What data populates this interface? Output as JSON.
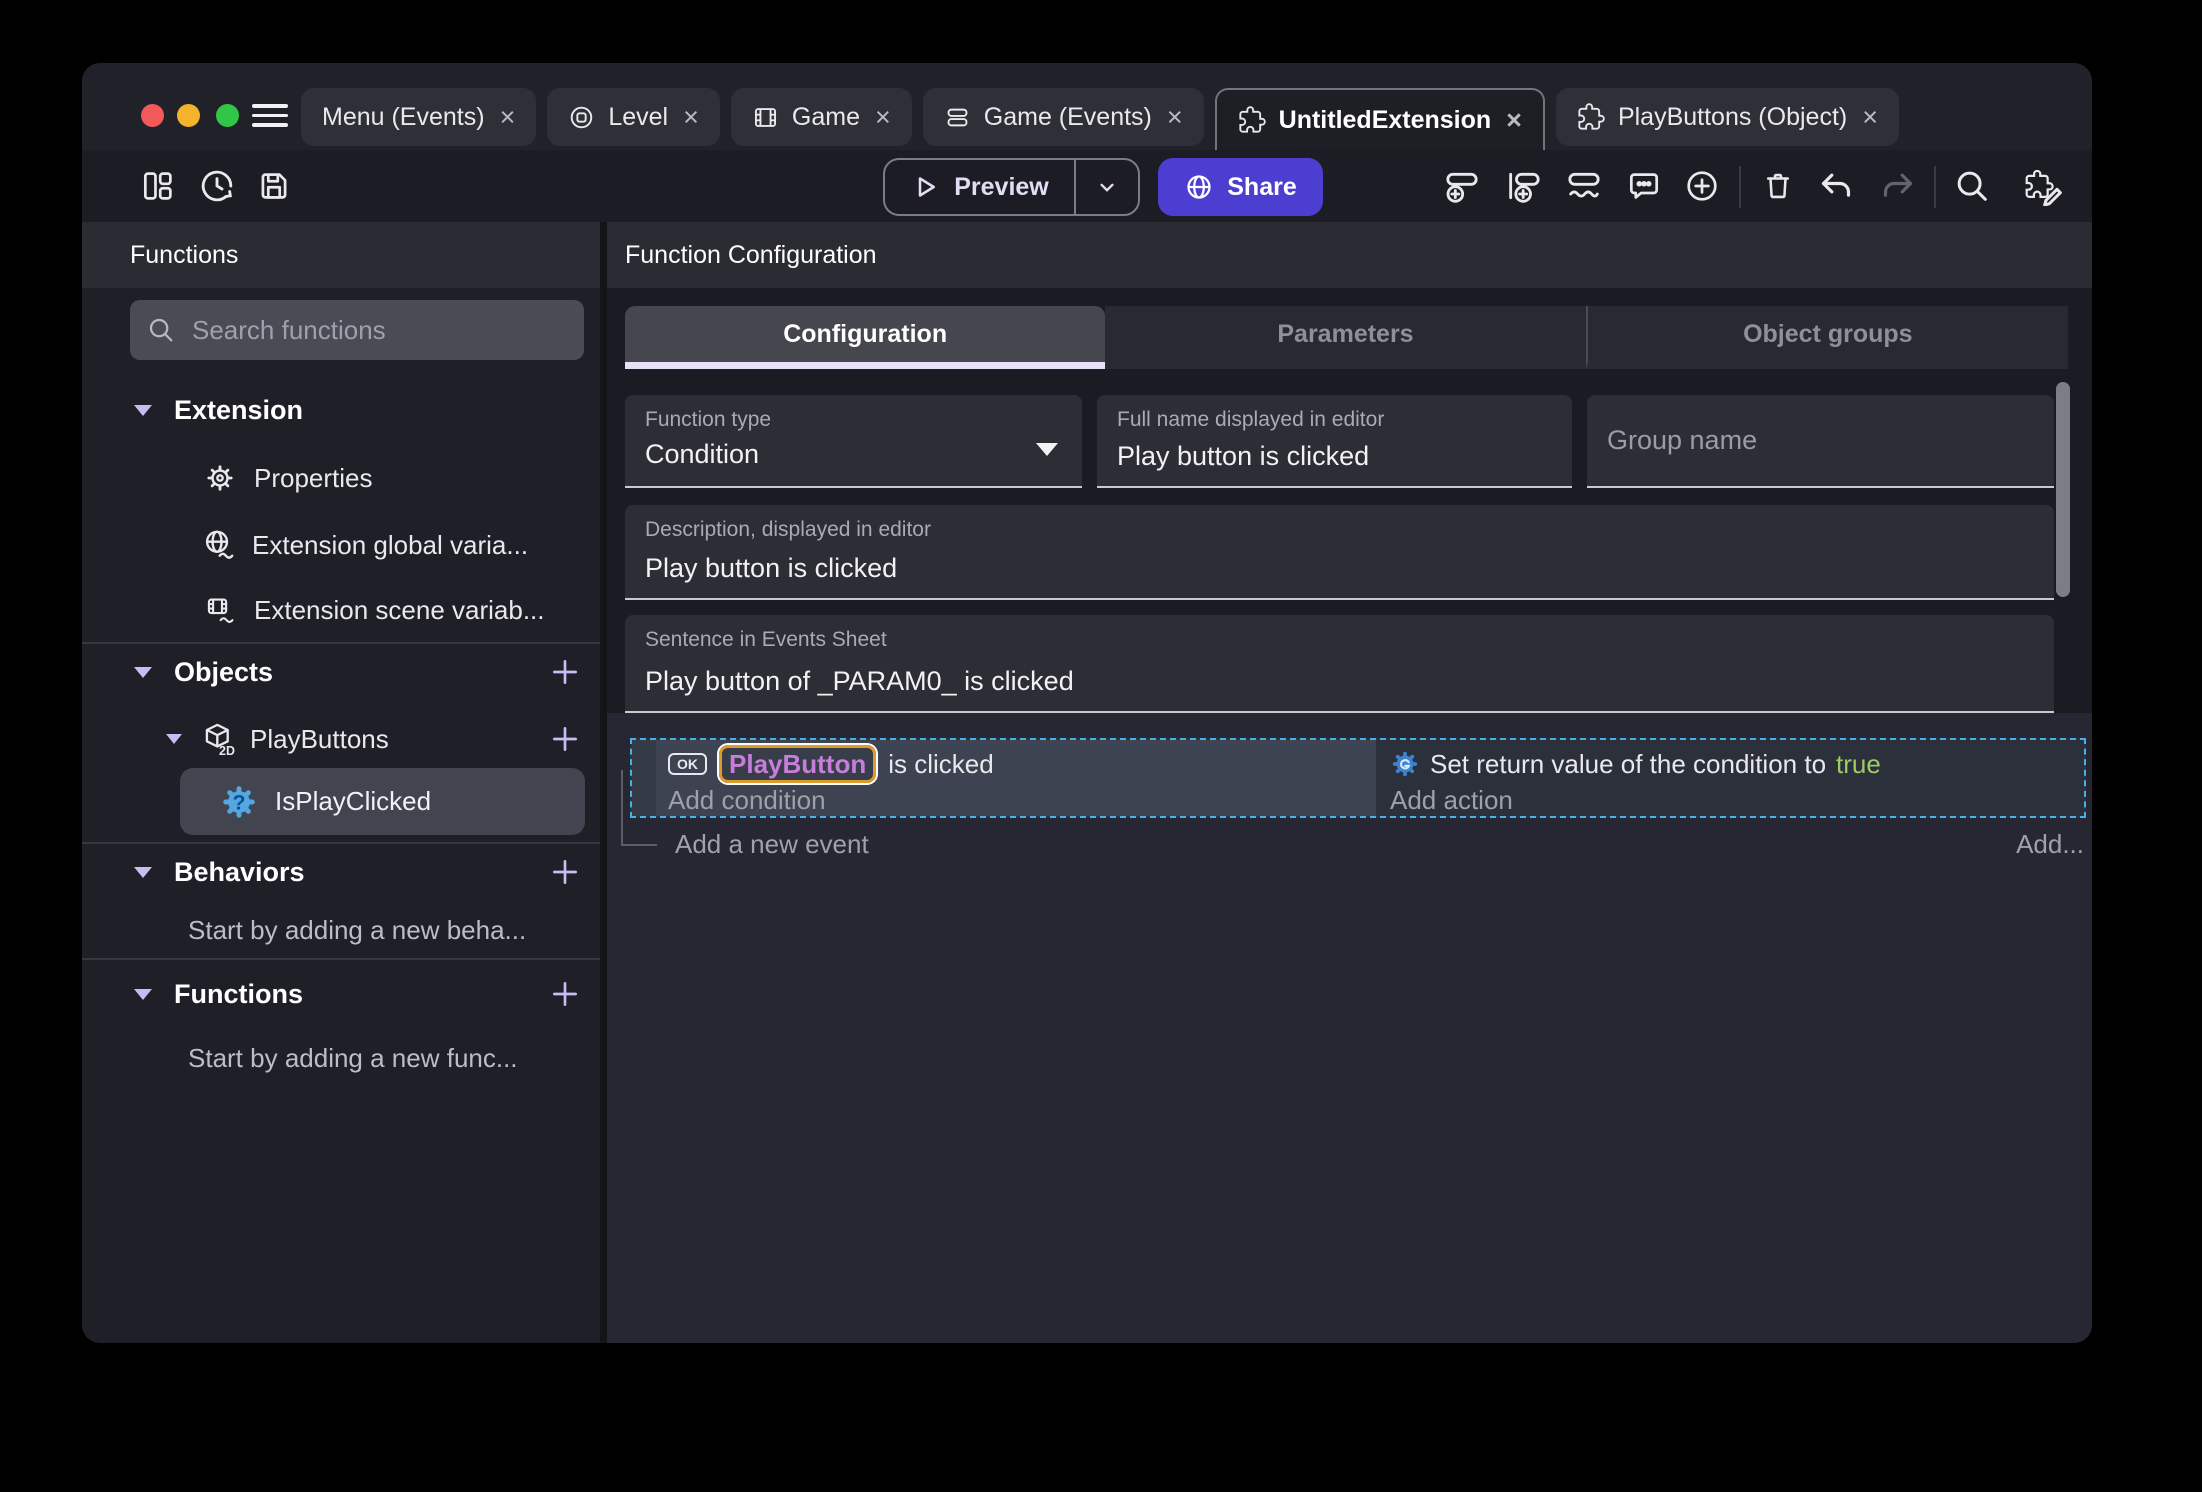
{
  "window_tabs": {
    "close_glyph": "×",
    "tabs": [
      {
        "label": "Menu (Events)"
      },
      {
        "label": "Level"
      },
      {
        "label": "Game"
      },
      {
        "label": "Game (Events)"
      },
      {
        "label": "UntitledExtension"
      },
      {
        "label": "PlayButtons (Object)"
      }
    ]
  },
  "toolbar": {
    "preview_label": "Preview",
    "share_label": "Share"
  },
  "sidebar": {
    "title": "Functions",
    "search_placeholder": "Search functions",
    "extension_header": "Extension",
    "items": {
      "properties": "Properties",
      "global_vars": "Extension global varia...",
      "scene_vars": "Extension scene variab..."
    },
    "objects_header": "Objects",
    "playbuttons": "PlayButtons",
    "playbuttons_badge": "2D",
    "selected_function": "IsPlayClicked",
    "behaviors_header": "Behaviors",
    "behaviors_empty": "Start by adding a new beha...",
    "functions_header": "Functions",
    "functions_empty": "Start by adding a new func..."
  },
  "main": {
    "title": "Function Configuration",
    "tabs": [
      {
        "label": "Configuration"
      },
      {
        "label": "Parameters"
      },
      {
        "label": "Object groups"
      }
    ],
    "function_type_label": "Function type",
    "function_type_value": "Condition",
    "full_name_label": "Full name displayed in editor",
    "full_name_value": "Play button is clicked",
    "group_name_placeholder": "Group name",
    "description_label": "Description, displayed in editor",
    "description_value": "Play button is clicked",
    "sentence_label": "Sentence in Events Sheet",
    "sentence_value": "Play button of _PARAM0_ is clicked"
  },
  "events": {
    "condition_object_chip": "OK",
    "condition_object": "PlayButton",
    "condition_text": "is clicked",
    "add_condition": "Add condition",
    "action_text": "Set return value of the condition to",
    "action_value": "true",
    "add_action": "Add action",
    "add_event": "Add a new event",
    "add_more": "Add...",
    "question_glyph": "?"
  },
  "colors": {
    "accent_purple": "#4d3ed2",
    "object_purple": "#c77edb",
    "highlight_orange": "#dd9a2f",
    "true_green": "#9ccc65",
    "selection_blue": "#45b1e8",
    "function_icon_blue": "#54a7e0"
  }
}
